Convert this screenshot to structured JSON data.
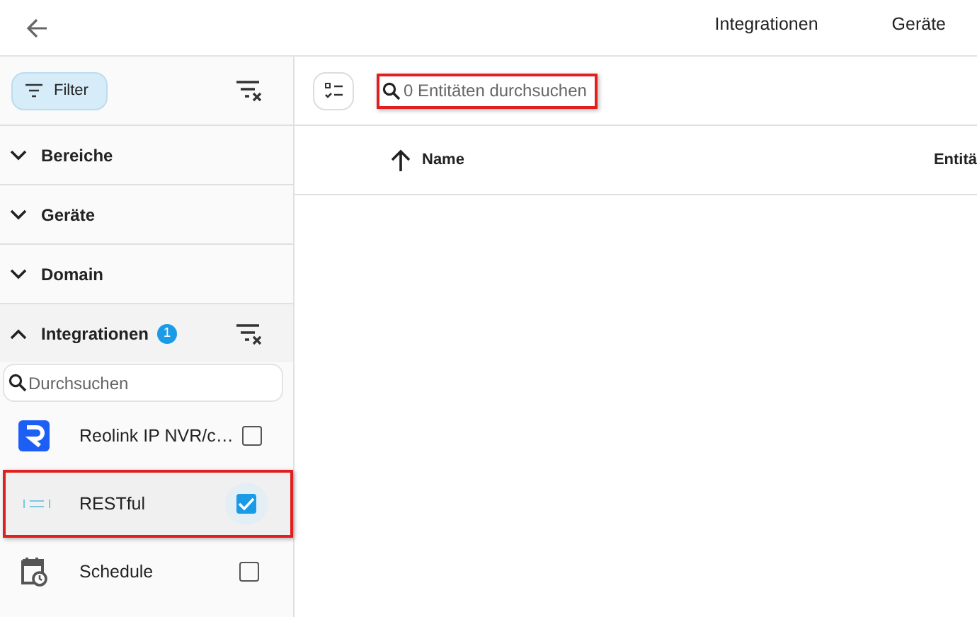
{
  "tabs": [
    {
      "label": "Integrationen",
      "selected": false
    },
    {
      "label": "Geräte",
      "selected": false
    }
  ],
  "sidebar": {
    "filter_button": "Filter",
    "sections": [
      {
        "label": "Bereiche",
        "expanded": false
      },
      {
        "label": "Geräte",
        "expanded": false
      },
      {
        "label": "Domain",
        "expanded": false
      },
      {
        "label": "Integrationen",
        "expanded": true,
        "badge": "1"
      }
    ],
    "search": {
      "placeholder": "Durchsuchen"
    },
    "items": [
      {
        "label": "Reolink IP NVR/c…",
        "kind": "reolink",
        "checked": false,
        "highlighted": false
      },
      {
        "label": "RESTful",
        "kind": "rest",
        "checked": true,
        "highlighted": true
      },
      {
        "label": "Schedule",
        "kind": "schedule",
        "checked": false,
        "highlighted": false
      }
    ]
  },
  "main": {
    "search": {
      "placeholder": "0 Entitäten durchsuchen",
      "highlighted": true
    },
    "columns": [
      {
        "label": "Name",
        "sorted": true
      },
      {
        "label": "Entitä",
        "sorted": false
      }
    ]
  }
}
